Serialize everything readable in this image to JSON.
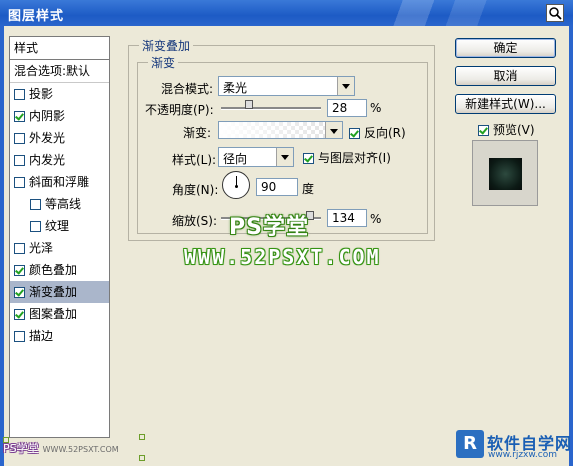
{
  "window": {
    "title": "图层样式"
  },
  "styles_list": {
    "header": "样式",
    "blend_options": "混合选项:默认",
    "items": [
      {
        "label": "投影",
        "checked": false,
        "indent": false,
        "selected": false
      },
      {
        "label": "内阴影",
        "checked": true,
        "indent": false,
        "selected": false
      },
      {
        "label": "外发光",
        "checked": false,
        "indent": false,
        "selected": false
      },
      {
        "label": "内发光",
        "checked": false,
        "indent": false,
        "selected": false
      },
      {
        "label": "斜面和浮雕",
        "checked": false,
        "indent": false,
        "selected": false
      },
      {
        "label": "等高线",
        "checked": false,
        "indent": true,
        "selected": false
      },
      {
        "label": "纹理",
        "checked": false,
        "indent": true,
        "selected": false
      },
      {
        "label": "光泽",
        "checked": false,
        "indent": false,
        "selected": false
      },
      {
        "label": "颜色叠加",
        "checked": true,
        "indent": false,
        "selected": false
      },
      {
        "label": "渐变叠加",
        "checked": true,
        "indent": false,
        "selected": true
      },
      {
        "label": "图案叠加",
        "checked": true,
        "indent": false,
        "selected": false
      },
      {
        "label": "描边",
        "checked": false,
        "indent": false,
        "selected": false
      }
    ]
  },
  "gradient_overlay": {
    "section_title": "渐变叠加",
    "subsection_title": "渐变",
    "blend_mode_label": "混合模式:",
    "blend_mode_value": "柔光",
    "opacity_label": "不透明度(P):",
    "opacity_value": "28",
    "opacity_unit": "%",
    "opacity_level": 0.28,
    "gradient_label": "渐变:",
    "reverse_label": "反向(R)",
    "reverse_checked": true,
    "style_label": "样式(L):",
    "style_value": "径向",
    "align_label": "与图层对齐(I)",
    "align_checked": true,
    "angle_label": "角度(N):",
    "angle_value": "90",
    "angle_unit": "度",
    "scale_label": "缩放(S):",
    "scale_value": "134",
    "scale_unit": "%"
  },
  "buttons": {
    "ok": "确定",
    "cancel": "取消",
    "new_style": "新建样式(W)...",
    "preview_label": "预览(V)",
    "preview_checked": true
  },
  "watermarks": {
    "center_title": "PS学堂",
    "center_url": "WWW.52PSXT.COM",
    "bottom_left": "PS学堂",
    "bottom_left_small": "WWW.52PSXT.COM",
    "brand_logo": "R",
    "brand_name": "软件自学网",
    "brand_url": "www.rjzxw.com"
  },
  "colors": {
    "titlebar": "#1d5bc5",
    "dialog_bg": "#ece9d8",
    "selected_item": "#aab6cb",
    "legend_text": "#16387c",
    "watermark_green": "#3b8a16"
  }
}
